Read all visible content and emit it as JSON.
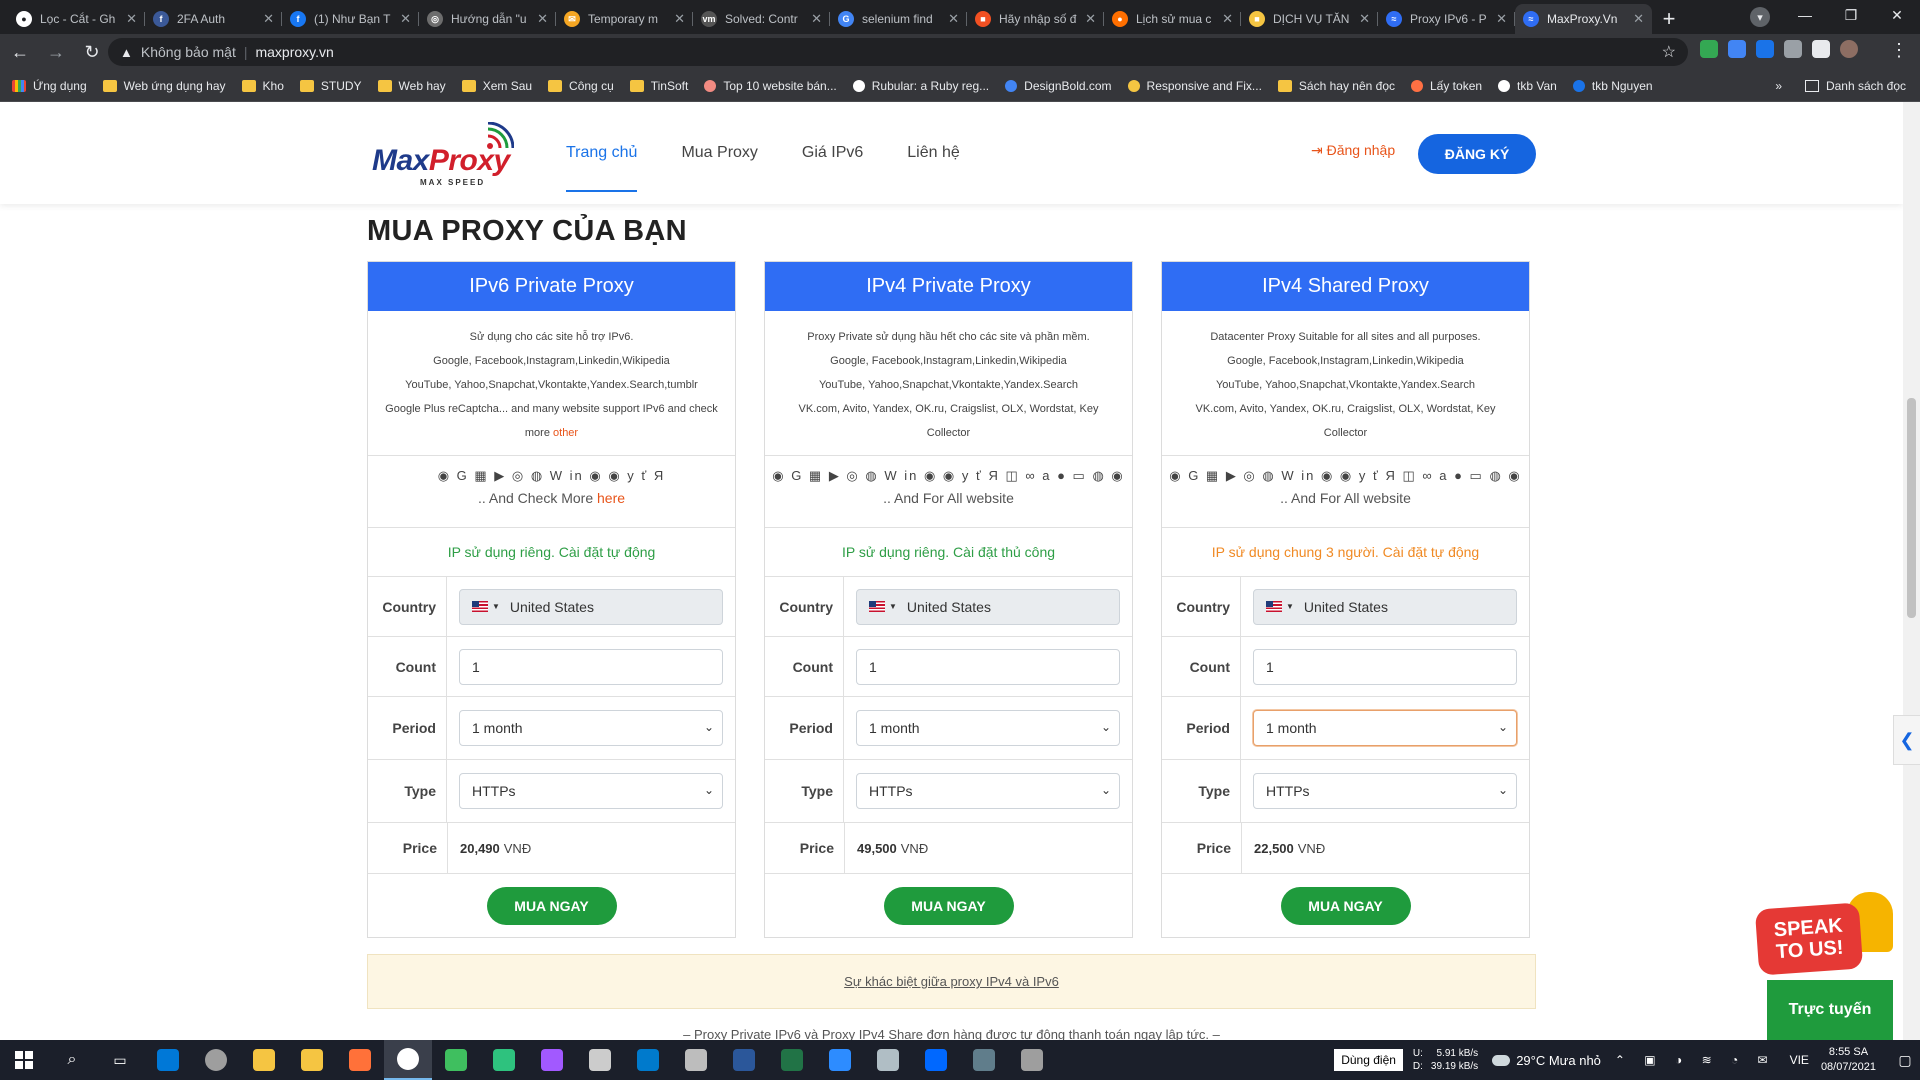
{
  "browser": {
    "tabs": [
      {
        "title": "Lọc - Cắt - Gh",
        "fav": "#ffffff",
        "glyph": "●"
      },
      {
        "title": "2FA Auth",
        "fav": "#3b5998",
        "glyph": "f"
      },
      {
        "title": "(1) Như Bạn T",
        "fav": "#1877f2",
        "glyph": "f"
      },
      {
        "title": "Hướng dẫn \"u",
        "fav": "#6d6d6d",
        "glyph": "◎"
      },
      {
        "title": "Temporary m",
        "fav": "#f5a623",
        "glyph": "✉"
      },
      {
        "title": "Solved: Contr",
        "fav": "#555555",
        "glyph": "vm"
      },
      {
        "title": "selenium find",
        "fav": "#4285f4",
        "glyph": "G"
      },
      {
        "title": "Hãy nhập số đ",
        "fav": "#f25022",
        "glyph": "■"
      },
      {
        "title": "Lịch sử mua c",
        "fav": "#ff6f00",
        "glyph": "●"
      },
      {
        "title": "DỊCH VỤ TĂN",
        "fav": "#f5c542",
        "glyph": "■"
      },
      {
        "title": "Proxy IPv6 - P",
        "fav": "#2f6df4",
        "glyph": "≈"
      },
      {
        "title": "MaxProxy.Vn",
        "fav": "#2f6df4",
        "glyph": "≈",
        "active": true
      }
    ],
    "address": {
      "security_label": "Không bảo mật",
      "url": "maxproxy.vn"
    },
    "bookmarks": [
      {
        "label": "Ứng dụng",
        "type": "apps"
      },
      {
        "label": "Web ứng dụng hay",
        "type": "folder"
      },
      {
        "label": "Kho",
        "type": "folder"
      },
      {
        "label": "STUDY",
        "type": "folder"
      },
      {
        "label": "Web hay",
        "type": "folder"
      },
      {
        "label": "Xem Sau",
        "type": "folder"
      },
      {
        "label": "Công cụ",
        "type": "folder"
      },
      {
        "label": "TinSoft",
        "type": "folder"
      },
      {
        "label": "Top 10 website bán...",
        "type": "site"
      },
      {
        "label": "Rubular: a Ruby reg...",
        "type": "site"
      },
      {
        "label": "DesignBold.com",
        "type": "site"
      },
      {
        "label": "Responsive and Fix...",
        "type": "site"
      },
      {
        "label": "Sách hay nên đọc",
        "type": "folder"
      },
      {
        "label": "Lấy token",
        "type": "site"
      },
      {
        "label": "tkb Van",
        "type": "site"
      },
      {
        "label": "tkb Nguyen",
        "type": "site"
      }
    ],
    "reading_list": "Danh sách đọc"
  },
  "site": {
    "logo": {
      "max": "Max",
      "proxy": "Proxy",
      "tagline": "MAX SPEED"
    },
    "nav": {
      "home": "Trang chủ",
      "buy": "Mua Proxy",
      "price": "Giá IPv6",
      "contact": "Liên hệ"
    },
    "login": "Đăng nhập",
    "register": "ĐĂNG KÝ",
    "section_title": "MUA PROXY CỦA BẠN",
    "labels": {
      "country": "Country",
      "count": "Count",
      "period": "Period",
      "type": "Type",
      "price": "Price",
      "buy": "MUA NGAY"
    },
    "cards": [
      {
        "title": "IPv6 Private Proxy",
        "desc_lines": [
          "Sử dụng cho các site hỗ trợ IPv6.",
          "Google, Facebook,Instagram,Linkedin,Wikipedia",
          "YouTube, Yahoo,Snapchat,Vkontakte,Yandex.Search,tumblr",
          "Google Plus reCaptcha... and many website support IPv6 and check"
        ],
        "desc_last": "more ",
        "desc_link": "other",
        "icons": "◉ G ▦ ▶ ◎ ◍ W in ◉ ◉ y ť Я",
        "icons_sub": ".. And Check More ",
        "icons_link": "here",
        "note": "IP sử dụng riêng. Cài đặt tự động",
        "note_color": "green",
        "country": "United States",
        "count": "1",
        "period": "1 month",
        "type": "HTTPs",
        "price": "20,490",
        "currency": "VNĐ"
      },
      {
        "title": "IPv4 Private Proxy",
        "desc_lines": [
          "Proxy Private sử dụng hầu hết cho các site và phần mềm.",
          "Google, Facebook,Instagram,Linkedin,Wikipedia",
          "YouTube, Yahoo,Snapchat,Vkontakte,Yandex.Search",
          "VK.com, Avito, Yandex, OK.ru, Craigslist, OLX, Wordstat, Key"
        ],
        "desc_last": "Collector",
        "desc_link": "",
        "icons": "◉ G ▦ ▶ ◎ ◍ W in ◉ ◉ y ť Я ◫ ∞ a ● ▭ ◍ ◉",
        "icons_sub": ".. And For All website",
        "icons_link": "",
        "note": "IP sử dụng riêng. Cài đặt thủ công",
        "note_color": "green",
        "country": "United States",
        "count": "1",
        "period": "1 month",
        "type": "HTTPs",
        "price": "49,500",
        "currency": "VNĐ"
      },
      {
        "title": "IPv4 Shared Proxy",
        "desc_lines": [
          "Datacenter Proxy Suitable for all sites and all purposes.",
          "Google, Facebook,Instagram,Linkedin,Wikipedia",
          "YouTube, Yahoo,Snapchat,Vkontakte,Yandex.Search",
          "VK.com, Avito, Yandex, OK.ru, Craigslist, OLX, Wordstat, Key"
        ],
        "desc_last": "Collector",
        "desc_link": "",
        "icons": "◉ G ▦ ▶ ◎ ◍ W in ◉ ◉ y ť Я ◫ ∞ a ● ▭ ◍ ◉",
        "icons_sub": ".. And For All website",
        "icons_link": "",
        "note": "IP sử dụng chung 3 người. Cài đặt tự động",
        "note_color": "orange",
        "country": "United States",
        "count": "1",
        "period": "1 month",
        "type": "HTTPs",
        "price": "22,500",
        "currency": "VNĐ",
        "period_focused": true
      }
    ],
    "diff_link": "Sự khác biệt giữa proxy IPv4 và IPv6",
    "footnote": "– Proxy Private IPv6 và Proxy IPv4 Share đơn hàng được tự động thanh toán ngay lập tức. –",
    "widget": {
      "speak_line1": "SPEAK",
      "speak_line2": "TO US!",
      "online": "Trực tuyến"
    }
  },
  "taskbar": {
    "apps": [
      "#0078d7",
      "#9e9e9e",
      "#f5c542",
      "#f5c542",
      "#ff7139",
      "#ffffff",
      "#3fbf5f",
      "#2ec27e",
      "#a259ff",
      "#cccccc",
      "#007acc",
      "#bdbdbd",
      "#2b579a",
      "#217346",
      "#2d8cff",
      "#b0bec5",
      "#0068ff",
      "#607d8b",
      "#9e9e9e"
    ],
    "lang_button": "Dùng điện",
    "net_upload_label": "U:",
    "net_download_label": "D:",
    "net_upload": "5.91 kB/s",
    "net_download": "39.19 kB/s",
    "weather": "29°C  Mưa nhỏ",
    "ime": "VIE",
    "time": "8:55 SA",
    "date": "08/07/2021"
  }
}
